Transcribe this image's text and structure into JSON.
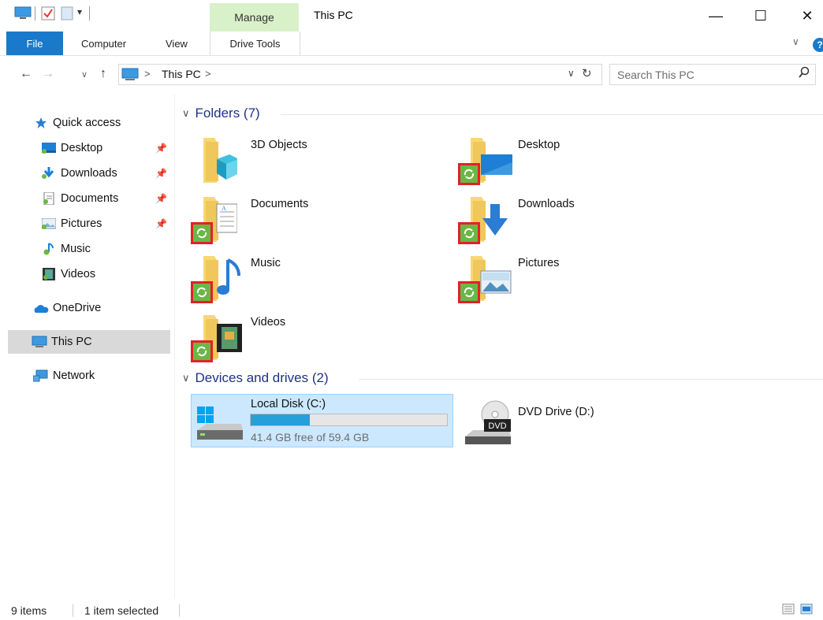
{
  "window": {
    "title": "This PC",
    "minimize": "—",
    "maximize": "☐",
    "close": "✕"
  },
  "ribbon": {
    "contextual_group": "Manage",
    "tabs": [
      "File",
      "Computer",
      "View",
      "Drive Tools"
    ],
    "collapse_glyph": "∨",
    "help_glyph": "?"
  },
  "address": {
    "back": "←",
    "forward": "→",
    "recent": "∨",
    "up": "↑",
    "sep": ">",
    "crumbs": [
      "This PC"
    ],
    "dropdown": "∨",
    "refresh": "↻"
  },
  "search": {
    "placeholder": "Search This PC",
    "icon": "search-icon"
  },
  "nav": {
    "items": [
      {
        "label": "Quick access",
        "icon": "star-icon",
        "pinned": false
      },
      {
        "label": "Desktop",
        "icon": "desktop-icon",
        "pinned": true
      },
      {
        "label": "Downloads",
        "icon": "downloads-icon",
        "pinned": true
      },
      {
        "label": "Documents",
        "icon": "documents-icon",
        "pinned": true
      },
      {
        "label": "Pictures",
        "icon": "pictures-icon",
        "pinned": true
      },
      {
        "label": "Music",
        "icon": "music-icon",
        "pinned": false
      },
      {
        "label": "Videos",
        "icon": "videos-icon",
        "pinned": false
      },
      {
        "label": "OneDrive",
        "icon": "onedrive-icon",
        "pinned": false
      },
      {
        "label": "This PC",
        "icon": "pc-icon",
        "pinned": false
      },
      {
        "label": "Network",
        "icon": "network-icon",
        "pinned": false
      }
    ],
    "pin_glyph": "📌"
  },
  "folders": {
    "header": "Folders (7)",
    "items": [
      {
        "name": "3D Objects",
        "overlay": "none"
      },
      {
        "name": "Desktop",
        "overlay": "sync"
      },
      {
        "name": "Documents",
        "overlay": "sync"
      },
      {
        "name": "Downloads",
        "overlay": "sync"
      },
      {
        "name": "Music",
        "overlay": "sync"
      },
      {
        "name": "Pictures",
        "overlay": "sync"
      },
      {
        "name": "Videos",
        "overlay": "sync"
      }
    ]
  },
  "devices": {
    "header": "Devices and drives (2)",
    "local_disk": {
      "name": "Local Disk (C:)",
      "free_text": "41.4 GB free of 59.4 GB",
      "used_fraction": 0.303
    },
    "dvd": {
      "name": "DVD Drive (D:)",
      "badge": "DVD"
    }
  },
  "status": {
    "items": "9 items",
    "selected": "1 item selected"
  },
  "colors": {
    "accent": "#1979ca",
    "manage_tab": "#d9f1c9",
    "selection": "#cce8ff",
    "sync_green": "#6ab844",
    "sync_highlight": "#e32029",
    "folder_yellow": "#f8d775"
  }
}
